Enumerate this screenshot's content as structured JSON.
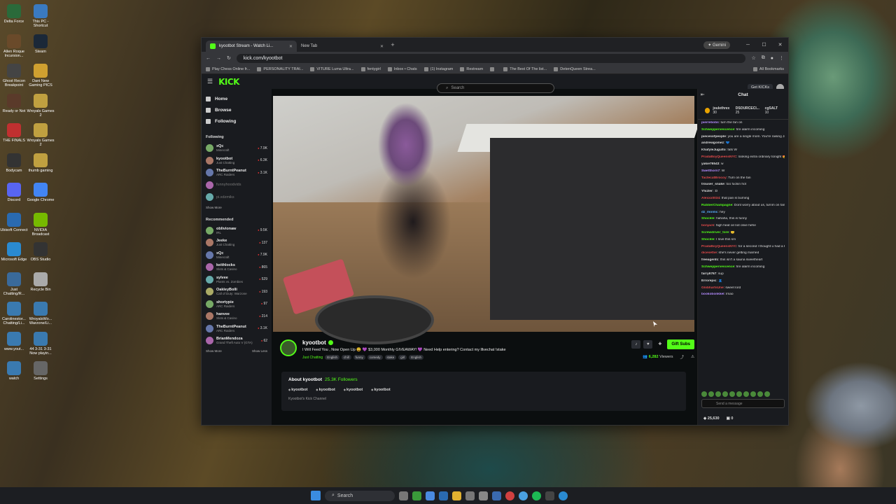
{
  "desktop": {
    "icons": [
      "Delta Force",
      "This PC - Shortcut",
      "Allen Roque Incursion...",
      "Steam",
      "Ghost Recon Breakpoint",
      "Dani New Gaming PICS",
      "Ready or Not",
      "Wroyals Games 2",
      "THE FINALS",
      "Wroyals Games 2",
      "Bodycam",
      "thumb gaming",
      "Discord",
      "Google Chrome",
      "Ubisoft Connect",
      "NVIDIA Broadcast",
      "Microsoft Edge",
      "OBS Studio",
      "Just Chatting/R...",
      "Recycle Bin",
      "Carolinestor... Chatting/Li...",
      "WroyalsWo... Warzone/Li...",
      "www.yout...",
      "44 3-31 3-31 Now playin...",
      "watch",
      "Settings"
    ]
  },
  "browser": {
    "tabs": [
      {
        "label": "kyootbot Stream - Watch Li...",
        "active": true
      },
      {
        "label": "New Tab",
        "active": false
      }
    ],
    "gemini": "Gemini",
    "url": "kick.com/kyootbot",
    "bookmarks": [
      "Play Chess Online fr...",
      "PERSONALITY TRAI...",
      "VITURE Luma Ultra...",
      "fentygirl",
      "Inbox • Chats",
      "(1) Instagram",
      "Restream",
      "",
      "The Best Of The list...",
      "DetenQueen Strea...",
      "All Bookmarks"
    ]
  },
  "kick": {
    "logo": "KICK",
    "search_placeholder": "Search",
    "get_kicks": "Get KICKs",
    "nav": [
      "Home",
      "Browse",
      "Following"
    ],
    "following_header": "Following",
    "following": [
      {
        "name": "xQc",
        "sub": "Minecraft",
        "viewers": "7.9K"
      },
      {
        "name": "kyootbot",
        "sub": "Just Chatting",
        "viewers": "6.3K"
      },
      {
        "name": "TheBurntPeanut",
        "sub": "ARC Raiders",
        "viewers": "3.1K"
      },
      {
        "name": "funnyhoodvids",
        "sub": "",
        "viewers": ""
      },
      {
        "name": "pi.xdzmiks",
        "sub": "",
        "viewers": ""
      }
    ],
    "show_more": "Show More",
    "recommended_header": "Recommended",
    "recommended": [
      {
        "name": "oblivionaw",
        "sub": "IRL",
        "viewers": "9.5K"
      },
      {
        "name": "Jeeke",
        "sub": "Just Chatting",
        "viewers": "137"
      },
      {
        "name": "xQc",
        "sub": "Minecraft",
        "viewers": "7.9K"
      },
      {
        "name": "keithlocks",
        "sub": "Slots & Casino",
        "viewers": "865"
      },
      {
        "name": "sylvee",
        "sub": "Plants vs. Zombies",
        "viewers": "529"
      },
      {
        "name": "OakleyBolli",
        "sub": "Call of Duty: Warzone",
        "viewers": "193"
      },
      {
        "name": "shortypie",
        "sub": "ARC Raiders",
        "viewers": "97"
      },
      {
        "name": "hanvee",
        "sub": "Slots & Casino",
        "viewers": "214"
      },
      {
        "name": "TheBurntPeanut",
        "sub": "ARC Raiders",
        "viewers": "3.1K"
      },
      {
        "name": "BrianMendoza",
        "sub": "Grand Theft Auto V (GTA)",
        "viewers": "62"
      }
    ],
    "show_more2": "Show More",
    "show_less": "Show Less",
    "stream": {
      "streamer": "kyootbot",
      "title": "I Will Feed You , Now Open Up 😩 💜 $3,000 Monthly GIVEAWAY! 💜 Need Help entering? Contact my lllvechat !stake",
      "category": "Just Chatting",
      "tags": [
        "English",
        "chill",
        "funny",
        "comedy",
        "stake",
        "girl",
        "English"
      ],
      "gift_subs": "Gift Subs",
      "viewers": "6,282",
      "viewers_label": "Viewers"
    },
    "about": {
      "title": "About kyootbot",
      "followers": "25.3K Followers",
      "socials": [
        "kyootbot",
        "kyootbot",
        "kyootbot",
        "kyootbot"
      ],
      "description": "Kyootbot's Kick Channel"
    },
    "chat": {
      "title": "Chat",
      "pinned": [
        "joulethrex",
        "30",
        "DSOURCECI...",
        "25",
        "cgSALT",
        "10"
      ],
      "messages": [
        {
          "user": "pierrebobs",
          "color": "#b58cff",
          "text": "turn the fan on"
        },
        {
          "user": "Schweppervescence",
          "color": "#53fc18",
          "text": "fire alarm incoming"
        },
        {
          "user": "piecesofpeople",
          "color": "#ddd",
          "text": "you are a single mom. You're raising Jah"
        },
        {
          "user": "andrewgomez",
          "color": "#ddd",
          "text": "💙"
        },
        {
          "user": "KhafyleJugulto",
          "color": "#ddd",
          "text": "fats W"
        },
        {
          "user": "PradaBoyQueensNYC",
          "color": "#e04a4a",
          "text": "looking extra ordinary tonight 😍"
        },
        {
          "user": "yakie76543",
          "color": "#ddd",
          "text": "w"
        },
        {
          "user": "Swetthorn7",
          "color": "#b58cff",
          "text": "W"
        },
        {
          "user": "TactecatBrocoy",
          "color": "#e04a4a",
          "text": "Turn on the fan"
        },
        {
          "user": "trouser_snake",
          "color": "#ddd",
          "text": "too fuckin hot"
        },
        {
          "user": "Yhizler",
          "color": "#ddd",
          "text": ":D"
        },
        {
          "user": "Alexxx0034",
          "color": "#e04a4a",
          "text": "that pan is burning"
        },
        {
          "user": "RubberChampagne",
          "color": "#53fc18",
          "text": "Dont worry about us, turnm on fan!"
        },
        {
          "user": "dz_monlic",
          "color": "#5ab0ff",
          "text": "hey"
        },
        {
          "user": "Shockle",
          "color": "#53fc18",
          "text": "hahaha, this is funny"
        },
        {
          "user": "bonjack",
          "color": "#e04a4a",
          "text": "high heat oil not olive hehe"
        },
        {
          "user": "Screwdriver_tore",
          "color": "#53fc18",
          "text": "😊"
        },
        {
          "user": "Shockle",
          "color": "#53fc18",
          "text": "I love this sm"
        },
        {
          "user": "PradaBoyQueensNYC",
          "color": "#e04a4a",
          "text": "for a second I thought u had a Halloween shirt on"
        },
        {
          "user": "dicesetlie",
          "color": "#e04a4a",
          "text": "she's never getting married"
        },
        {
          "user": "freeagentc",
          "color": "#ddd",
          "text": "this isn't a sauna sweetheart"
        },
        {
          "user": "Schweppervescence",
          "color": "#53fc18",
          "text": "fire alarm incoming"
        },
        {
          "user": "farry6767",
          "color": "#ddd",
          "text": "sup"
        },
        {
          "user": "Errorepic",
          "color": "#ddd",
          "text": "👤"
        },
        {
          "user": "GlobhartsUne",
          "color": "#e04a4a",
          "text": "sweet lord"
        },
        {
          "user": "bookobonkkel",
          "color": "#b58cff",
          "text": "lmao"
        }
      ],
      "send_placeholder": "Send a message",
      "kicks": "25,630",
      "count": "0"
    }
  },
  "taskbar": {
    "search": "Search"
  }
}
